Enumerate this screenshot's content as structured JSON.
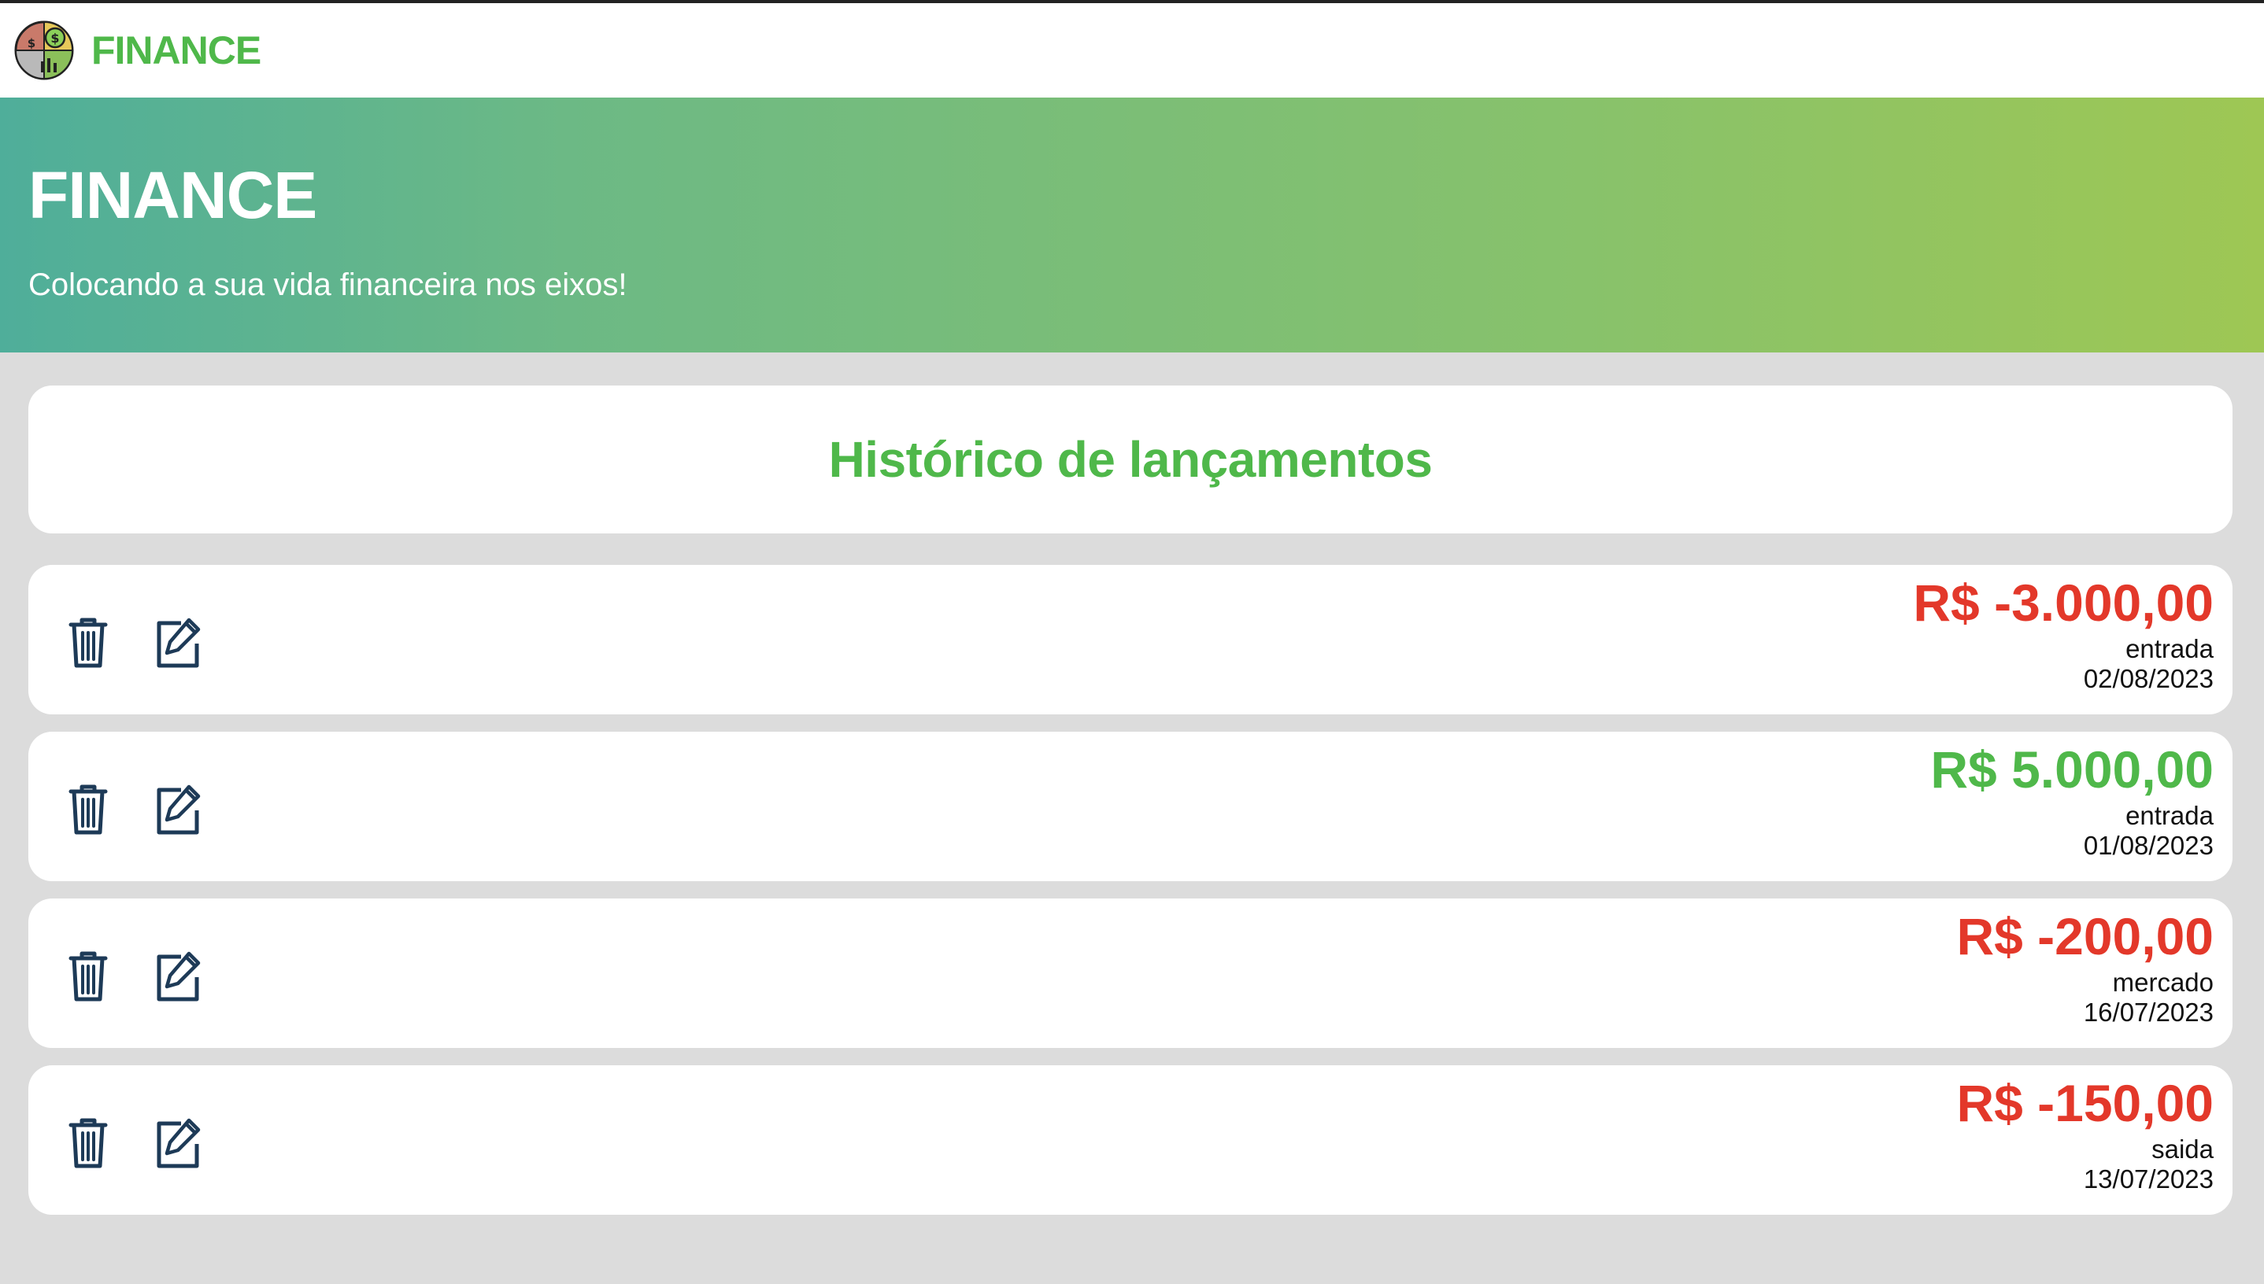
{
  "navbar": {
    "brand": "FINANCE",
    "logo_icon": "finance-pie-coin-icon"
  },
  "hero": {
    "title": "FINANCE",
    "subtitle": "Colocando a sua vida financeira nos eixos!"
  },
  "history": {
    "title": "Histórico de lançamentos"
  },
  "colors": {
    "brand_green": "#4fb84a",
    "negative_red": "#e3382a",
    "icon_navy": "#1d3a57"
  },
  "transactions": [
    {
      "amount": "R$ -3.000,00",
      "category": "entrada",
      "date": "02/08/2023",
      "type": "negative"
    },
    {
      "amount": "R$ 5.000,00",
      "category": "entrada",
      "date": "01/08/2023",
      "type": "positive"
    },
    {
      "amount": "R$ -200,00",
      "category": "mercado",
      "date": "16/07/2023",
      "type": "negative"
    },
    {
      "amount": "R$ -150,00",
      "category": "saida",
      "date": "13/07/2023",
      "type": "negative"
    }
  ],
  "actions": {
    "delete_icon": "trash-icon",
    "edit_icon": "edit-icon"
  }
}
